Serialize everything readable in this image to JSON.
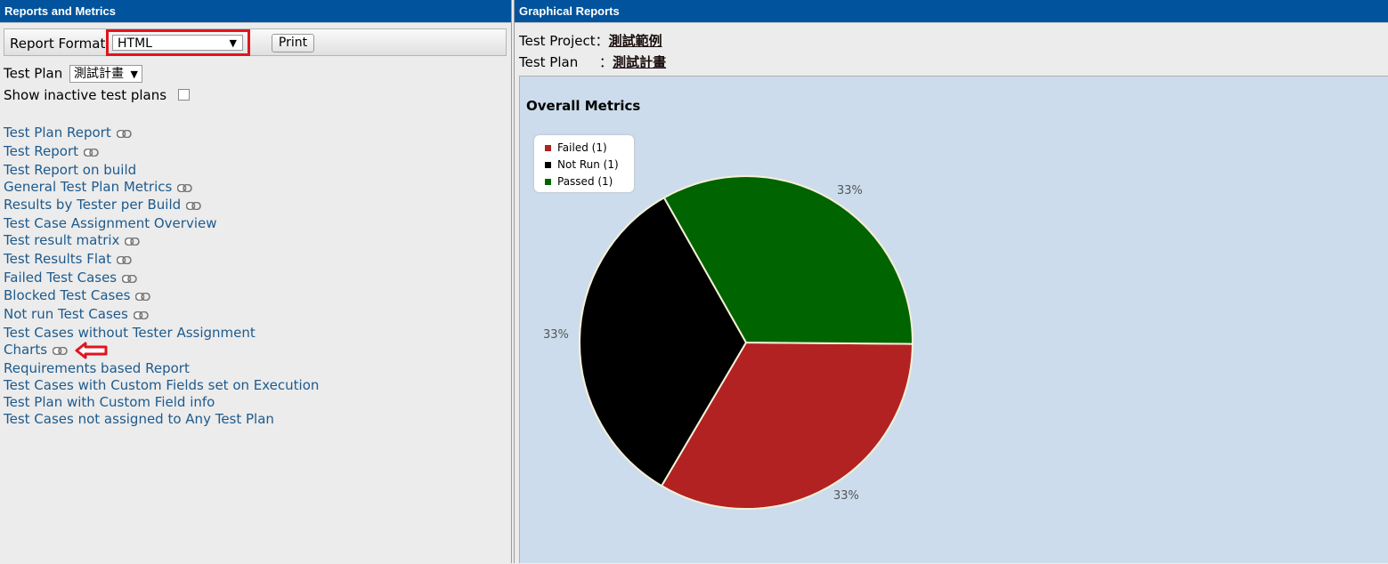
{
  "left_panel": {
    "title": "Reports and Metrics",
    "toolbar": {
      "format_label": "Report Format",
      "format_value": "HTML",
      "print_label": "Print"
    },
    "test_plan_label": "Test Plan",
    "test_plan_value": "測試計畫",
    "show_inactive_label": "Show inactive test plans",
    "reports": [
      {
        "label": "Test Plan Report",
        "has_link_icon": true
      },
      {
        "label": "Test Report",
        "has_link_icon": true
      },
      {
        "label": "Test Report on build",
        "has_link_icon": false
      },
      {
        "label": "General Test Plan Metrics",
        "has_link_icon": true
      },
      {
        "label": "Results by Tester per Build",
        "has_link_icon": true
      },
      {
        "label": "Test Case Assignment Overview",
        "has_link_icon": false
      },
      {
        "label": "Test result matrix",
        "has_link_icon": true
      },
      {
        "label": "Test Results Flat",
        "has_link_icon": true
      },
      {
        "label": "Failed Test Cases",
        "has_link_icon": true
      },
      {
        "label": "Blocked Test Cases",
        "has_link_icon": true
      },
      {
        "label": "Not run Test Cases",
        "has_link_icon": true
      },
      {
        "label": "Test Cases without Tester Assignment",
        "has_link_icon": false
      },
      {
        "label": "Charts",
        "has_link_icon": true
      },
      {
        "label": "Requirements based Report",
        "has_link_icon": false
      },
      {
        "label": "Test Cases with Custom Fields set on Execution",
        "has_link_icon": false
      },
      {
        "label": "Test Plan with Custom Field info",
        "has_link_icon": false
      },
      {
        "label": "Test Cases not assigned to Any Test Plan",
        "has_link_icon": false
      }
    ]
  },
  "right_panel": {
    "title": "Graphical Reports",
    "project_label": "Test Project：",
    "project_value": "測試範例",
    "plan_label": "Test Plan     ：",
    "plan_value": "測試計畫"
  },
  "colors": {
    "failed": "#b22222",
    "not_run": "#000000",
    "passed": "#006400",
    "title_bar": "#00539c",
    "link": "#1e5a8c"
  },
  "chart_data": {
    "type": "pie",
    "title": "Overall Metrics",
    "legend_position": "top-left",
    "slices": [
      {
        "label": "Failed (1)",
        "value": 1,
        "percent": "33%",
        "color": "#b22222"
      },
      {
        "label": "Not Run (1)",
        "value": 1,
        "percent": "33%",
        "color": "#000000"
      },
      {
        "label": "Passed (1)",
        "value": 1,
        "percent": "33%",
        "color": "#006400"
      }
    ]
  }
}
